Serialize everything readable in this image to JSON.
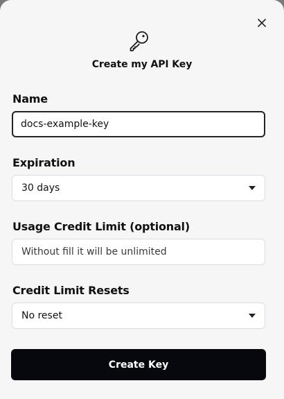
{
  "modal": {
    "title": "Create my API Key",
    "close_icon": "close-icon",
    "header_icon": "key-icon"
  },
  "name": {
    "label": "Name",
    "value": "docs-example-key"
  },
  "expiration": {
    "label": "Expiration",
    "selected": "30 days",
    "icon": "chevron-down-icon"
  },
  "usage_limit": {
    "label": "Usage Credit Limit (optional)",
    "placeholder": "Without fill it will be unlimited"
  },
  "credit_resets": {
    "label": "Credit Limit Resets",
    "selected": "No reset",
    "icon": "chevron-down-icon"
  },
  "submit": {
    "label": "Create Key"
  },
  "colors": {
    "modal_background": "#f6f6f6",
    "button_background": "#06080d",
    "button_text": "#ffffff",
    "active_border": "#222222",
    "field_border": "#d8dce3"
  }
}
